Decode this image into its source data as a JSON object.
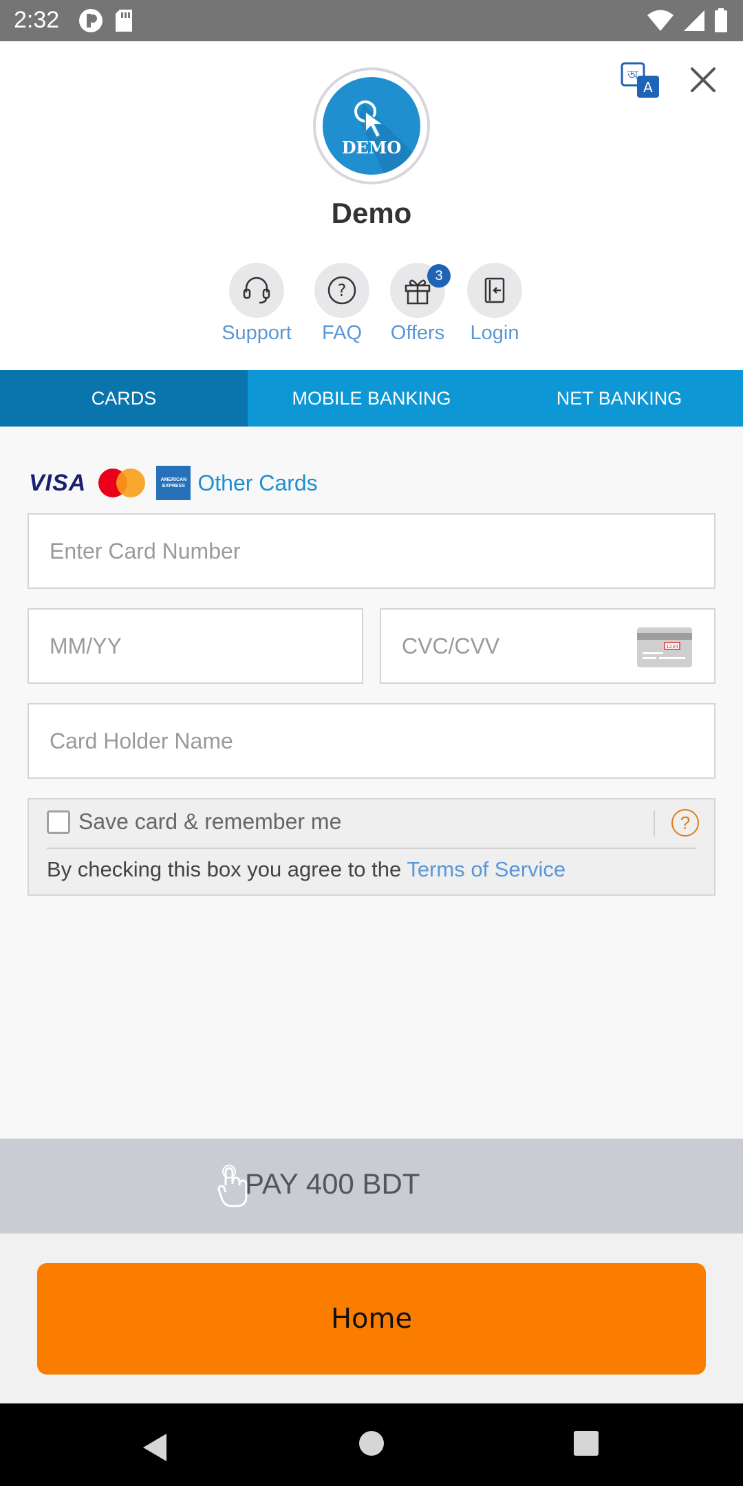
{
  "status_bar": {
    "time": "2:32"
  },
  "header": {
    "logo_text": "DEMO",
    "merchant_name": "Demo",
    "quick_links": [
      {
        "label": "Support"
      },
      {
        "label": "FAQ"
      },
      {
        "label": "Offers",
        "badge": "3"
      },
      {
        "label": "Login"
      }
    ]
  },
  "tabs": [
    {
      "label": "CARDS",
      "active": true
    },
    {
      "label": "MOBILE BANKING",
      "active": false
    },
    {
      "label": "NET BANKING",
      "active": false
    }
  ],
  "card_form": {
    "brands": {
      "visa": "VISA",
      "amex": "AMERICAN EXPRESS",
      "other_cards": "Other Cards"
    },
    "card_number_placeholder": "Enter Card Number",
    "expiry_placeholder": "MM/YY",
    "cvc_placeholder": "CVC/CVV",
    "cvc_card_text": "1234",
    "holder_name_placeholder": "Card Holder Name",
    "save_card_label": "Save card & remember me",
    "save_card_checked": false,
    "help_symbol": "?",
    "terms_prefix": "By checking this box you agree to the ",
    "terms_link": "Terms of Service"
  },
  "pay": {
    "label": "PAY 400 BDT"
  },
  "home_button": {
    "label": "Home"
  },
  "colors": {
    "tab_bar": "#0e97d5",
    "tab_active": "#0a74ad",
    "link": "#5a97d6",
    "home_button": "#fa7d00",
    "pay_bar": "#c9ccd3",
    "help_icon": "#e07b1a"
  },
  "icons": {
    "language": "translate-icon",
    "close": "close-icon",
    "support": "headset-icon",
    "faq": "question-icon",
    "offers": "gift-icon",
    "login": "login-door-icon",
    "pay": "tap-hand-icon"
  }
}
